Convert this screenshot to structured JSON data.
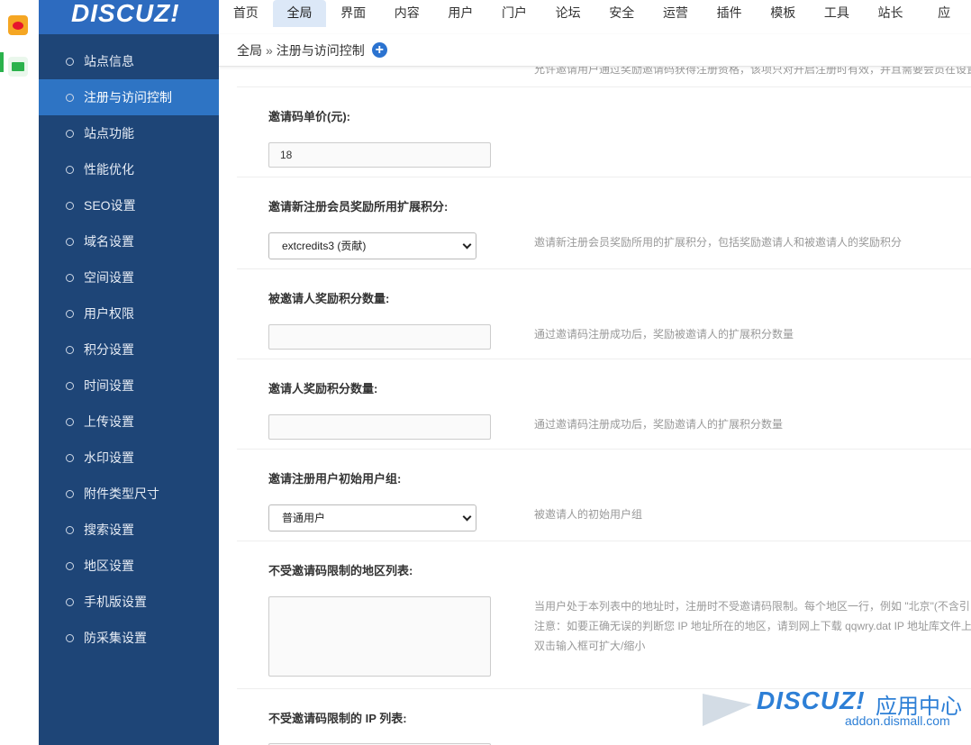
{
  "logo": "DISCUZ!",
  "topnav": [
    "首页",
    "全局",
    "界面",
    "内容",
    "用户",
    "门户",
    "论坛",
    "安全",
    "运营",
    "插件",
    "模板",
    "工具",
    "站长",
    "应"
  ],
  "topnav_active": 1,
  "breadcrumb": {
    "root": "全局",
    "sep": "»",
    "current": "注册与访问控制",
    "add_icon": "plus-icon"
  },
  "sidebar": {
    "items": [
      {
        "label": "站点信息"
      },
      {
        "label": "注册与访问控制",
        "active": true
      },
      {
        "label": "站点功能"
      },
      {
        "label": "性能优化"
      },
      {
        "label": "SEO设置"
      },
      {
        "label": "域名设置"
      },
      {
        "label": "空间设置"
      },
      {
        "label": "用户权限"
      },
      {
        "label": "积分设置"
      },
      {
        "label": "时间设置"
      },
      {
        "label": "上传设置"
      },
      {
        "label": "水印设置"
      },
      {
        "label": "附件类型尺寸"
      },
      {
        "label": "搜索设置"
      },
      {
        "label": "地区设置"
      },
      {
        "label": "手机版设置"
      },
      {
        "label": "防采集设置"
      }
    ]
  },
  "cut_row": {
    "text": "允许邀请用户通过奖励邀请码获得注册资格，该项只对开启注册时有效，并且需要会员在设置中开通邀请功能"
  },
  "fields": {
    "price": {
      "label": "邀请码单价(元):",
      "value": "18"
    },
    "credit_type": {
      "label": "邀请新注册会员奖励所用扩展积分:",
      "value": "extcredits3 (贡献)",
      "desc": "邀请新注册会员奖励所用的扩展积分，包括奖励邀请人和被邀请人的奖励积分"
    },
    "invitee_reward": {
      "label": "被邀请人奖励积分数量:",
      "value": "",
      "desc": "通过邀请码注册成功后，奖励被邀请人的扩展积分数量"
    },
    "inviter_reward": {
      "label": "邀请人奖励积分数量:",
      "value": "",
      "desc": "通过邀请码注册成功后，奖励邀请人的扩展积分数量"
    },
    "initial_group": {
      "label": "邀请注册用户初始用户组:",
      "value": "普通用户",
      "desc": "被邀请人的初始用户组"
    },
    "region_list": {
      "label": "不受邀请码限制的地区列表:",
      "desc1": "当用户处于本列表中的地址时，注册时不受邀请码限制。每个地区一行，例如 \"北京\"(不含引",
      "desc2": "注意：如要正确无误的判断您 IP 地址所在的地区，请到网上下载 qqwry.dat IP 地址库文件上",
      "desc3": "双击输入框可扩大/缩小"
    },
    "ip_list": {
      "label": "不受邀请码限制的 IP 列表:"
    }
  },
  "watermark": {
    "logo": "DISCUZ!",
    "cn": "应用中心",
    "url": "addon.dismall.com"
  }
}
